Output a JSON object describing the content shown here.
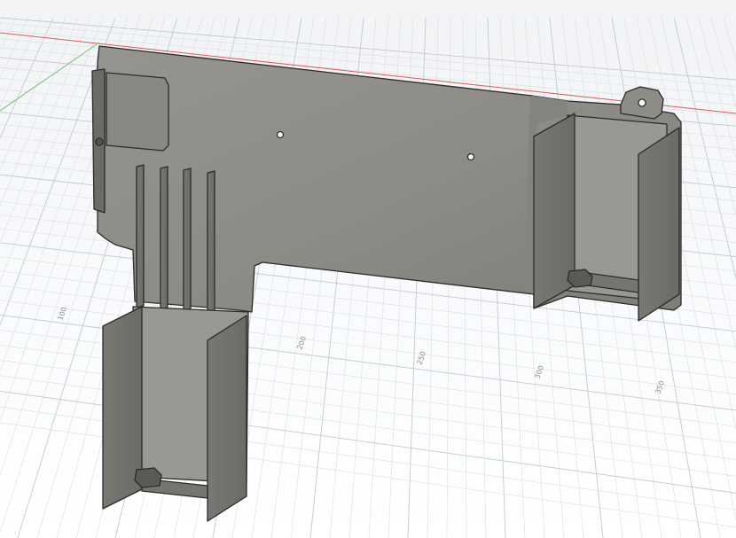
{
  "viewport": {
    "grid_minor_color": "#d9dde2",
    "grid_major_color": "#c4c9cf",
    "x_axis_color": "#d65a5a",
    "y_axis_color": "#6fbf73",
    "background_top": "#f2f3f5",
    "background_bottom": "#ffffff"
  },
  "ruler": {
    "labels": [
      "100",
      "150",
      "200",
      "250",
      "300",
      "350"
    ]
  },
  "model": {
    "plate_color": "#8e8c86",
    "plate_shade": "#77756f",
    "edge_color": "#2b2b2b",
    "hole_color": "#ffffff"
  }
}
